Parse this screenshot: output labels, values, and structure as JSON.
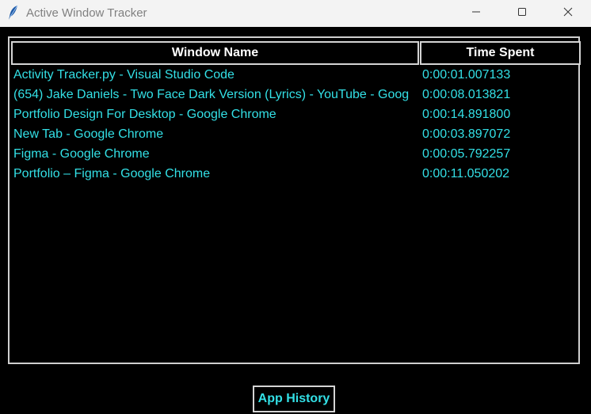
{
  "window": {
    "title": "Active Window Tracker",
    "controls": {
      "minimize": "minimize-icon",
      "maximize": "maximize-icon",
      "close": "close-icon"
    }
  },
  "table": {
    "headers": {
      "window_name": "Window Name",
      "time_spent": "Time Spent"
    },
    "rows": [
      {
        "name": "Activity Tracker.py - Visual Studio Code",
        "time": "0:00:01.007133"
      },
      {
        "name": "(654) Jake Daniels - Two Face Dark Version (Lyrics) - YouTube - Goog",
        "time": "0:00:08.013821"
      },
      {
        "name": "Portfolio Design For Desktop - Google Chrome",
        "time": "0:00:14.891800"
      },
      {
        "name": "New Tab - Google Chrome",
        "time": "0:00:03.897072"
      },
      {
        "name": "Figma - Google Chrome",
        "time": "0:00:05.792257"
      },
      {
        "name": "Portfolio – Figma - Google Chrome",
        "time": "0:00:11.050202"
      }
    ]
  },
  "footer": {
    "history_button": "App History"
  },
  "colors": {
    "background": "#000000",
    "text_accent": "#33e0e6",
    "header_text": "#ffffff",
    "border": "#d4d4d4",
    "titlebar": "#f3f3f3"
  }
}
